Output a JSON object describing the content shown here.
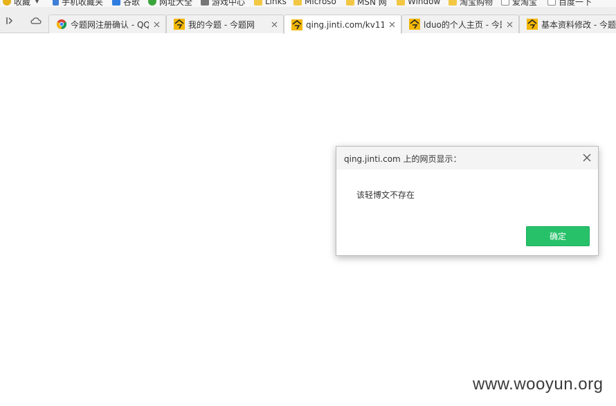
{
  "bookmarks": [
    {
      "label": "收藏",
      "icon": "star-icon"
    },
    {
      "label": "手机收藏夹",
      "icon": "phone-icon"
    },
    {
      "label": "谷歌",
      "icon": "google-icon"
    },
    {
      "label": "网址大全",
      "icon": "globe-icon"
    },
    {
      "label": "游戏中心",
      "icon": "gamepad-icon"
    },
    {
      "label": "Links",
      "icon": "folder-icon"
    },
    {
      "label": "Microso",
      "icon": "folder-icon"
    },
    {
      "label": "MSN 网",
      "icon": "folder-icon"
    },
    {
      "label": "Window",
      "icon": "folder-icon"
    },
    {
      "label": "淘宝购物",
      "icon": "folder-icon"
    },
    {
      "label": "爱淘宝",
      "icon": "page-icon"
    },
    {
      "label": "百度一下",
      "icon": "page-icon"
    }
  ],
  "tabs": [
    {
      "title": "今题网注册确认 - QQ",
      "favicon": "chrome-icon",
      "active": false
    },
    {
      "title": "我的今题 - 今题网",
      "favicon": "jinti-icon",
      "active": false
    },
    {
      "title": "qing.jinti.com/kv11",
      "favicon": "jinti-icon",
      "active": true
    },
    {
      "title": "lduo的个人主页 - 今题",
      "favicon": "jinti-icon",
      "active": false
    },
    {
      "title": "基本资料修改 - 今题",
      "favicon": "jinti-icon",
      "active": false
    }
  ],
  "dialog": {
    "title": "qing.jinti.com 上的网页显示：",
    "message": "该轻博文不存在",
    "ok_label": "确定"
  },
  "watermark": "www.wooyun.org",
  "colors": {
    "ok_button": "#27c16a",
    "tabbar_bg": "#eeeeee",
    "dialog_header": "#f4f4f4"
  }
}
